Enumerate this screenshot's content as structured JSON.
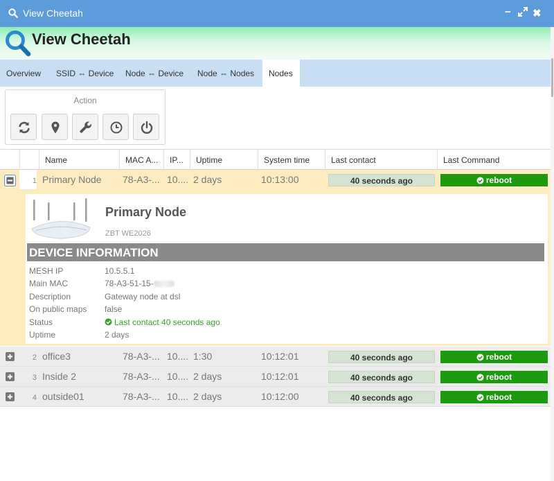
{
  "window": {
    "title": "View Cheetah",
    "header_title": "View Cheetah",
    "controls": {
      "minimize": "−",
      "maximize": "⤢",
      "close": "✖"
    }
  },
  "tabs": [
    {
      "label": "Overview",
      "active": false
    },
    {
      "label": "SSID ⇔ Device",
      "active": false
    },
    {
      "label": "Node ⇔ Device",
      "active": false
    },
    {
      "label": "Node ⇔ Nodes",
      "active": false
    },
    {
      "label": "Nodes",
      "active": true
    }
  ],
  "action": {
    "label": "Action",
    "buttons": [
      "refresh-icon",
      "map-marker-icon",
      "wrench-icon",
      "clock-icon",
      "power-icon"
    ]
  },
  "columns": [
    "Name",
    "MAC A...",
    "IP...",
    "Uptime",
    "System time",
    "Last contact",
    "Last Command"
  ],
  "rows": [
    {
      "num": "1",
      "name": "Primary Node",
      "mac": "78-A3-...",
      "ip": "10....",
      "uptime": "2 days",
      "system_time": "10:13:00",
      "last_contact": "40 seconds ago",
      "last_command": "reboot",
      "expanded": true
    },
    {
      "num": "2",
      "name": "office3",
      "mac": "78-A3-...",
      "ip": "10....",
      "uptime": "1:30",
      "system_time": "10:12:01",
      "last_contact": "40 seconds ago",
      "last_command": "reboot",
      "expanded": false
    },
    {
      "num": "3",
      "name": "Inside 2",
      "mac": "78-A3-...",
      "ip": "10....",
      "uptime": "2 days",
      "system_time": "10:12:01",
      "last_contact": "40 seconds ago",
      "last_command": "reboot",
      "expanded": false
    },
    {
      "num": "4",
      "name": "outside01",
      "mac": "78-A3-...",
      "ip": "10....",
      "uptime": "2 days",
      "system_time": "10:12:00",
      "last_contact": "40 seconds ago",
      "last_command": "reboot",
      "expanded": false
    }
  ],
  "detail": {
    "name": "Primary Node",
    "model": "ZBT WE2026",
    "section_title": "DEVICE INFORMATION",
    "fields": [
      {
        "key": "MESH IP",
        "value": "10.5.5.1"
      },
      {
        "key": "Main MAC",
        "value": "78-A3-51-15-"
      },
      {
        "key": "Description",
        "value": "Gateway node at dsl"
      },
      {
        "key": "On public maps",
        "value": "false"
      },
      {
        "key": "Status",
        "value": "Last contact 40 seconds ago"
      },
      {
        "key": "Uptime",
        "value": "2 days"
      }
    ]
  },
  "colors": {
    "titlebar": "#5b9bd9",
    "tabs_bg": "#c8def3",
    "selected_row": "#fcecc0",
    "command_green": "#1e9a10",
    "contact_bg": "#d5e3d3",
    "status_ok": "#3aa12c"
  }
}
